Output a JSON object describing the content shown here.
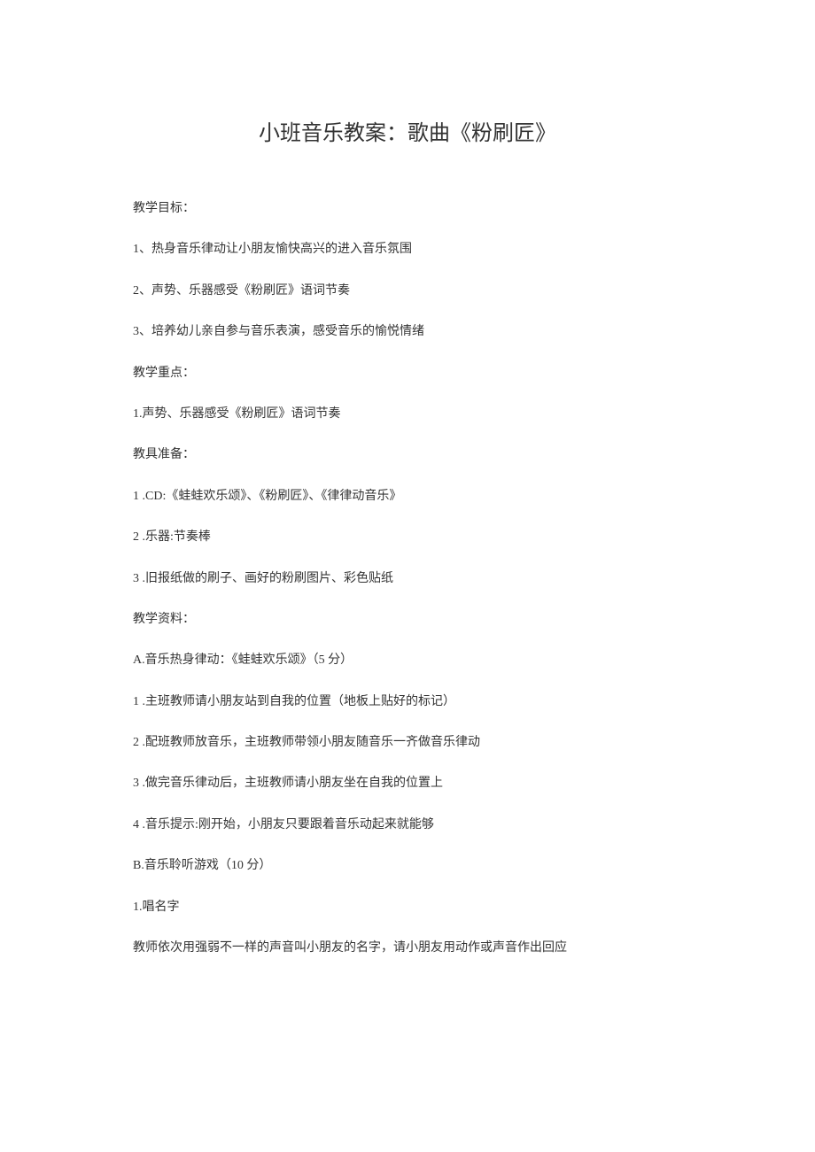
{
  "title": "小班音乐教案：歌曲《粉刷匠》",
  "sections": {
    "goals": {
      "label": "教学目标：",
      "items": [
        "1、热身音乐律动让小朋友愉快高兴的进入音乐氛围",
        "2、声势、乐器感受《粉刷匠》语词节奏",
        "3、培养幼儿亲自参与音乐表演，感受音乐的愉悦情绪"
      ]
    },
    "focus": {
      "label": "教学重点：",
      "items": [
        "1.声势、乐器感受《粉刷匠》语词节奏"
      ]
    },
    "materials": {
      "label": "教具准备：",
      "items": [
        "1 .CD:《蛙蛙欢乐颂》、《粉刷匠》、《律律动音乐》",
        "2 .乐器:节奏棒",
        "3 .旧报纸做的刷子、画好的粉刷图片、彩色贴纸"
      ]
    },
    "content": {
      "label": "教学资料：",
      "partA": {
        "heading": "A.音乐热身律动：《蛙蛙欢乐颂》（5 分）",
        "items": [
          "1 .主班教师请小朋友站到自我的位置（地板上贴好的标记）",
          "2 .配班教师放音乐，主班教师带领小朋友随音乐一齐做音乐律动",
          "3 .做完音乐律动后，主班教师请小朋友坐在自我的位置上",
          "4 .音乐提示:刚开始，小朋友只要跟着音乐动起来就能够"
        ]
      },
      "partB": {
        "heading": "B.音乐聆听游戏（10 分）",
        "sub1": "1.唱名字",
        "paragraph": "教师依次用强弱不一样的声音叫小朋友的名字，请小朋友用动作或声音作出回应"
      }
    }
  }
}
